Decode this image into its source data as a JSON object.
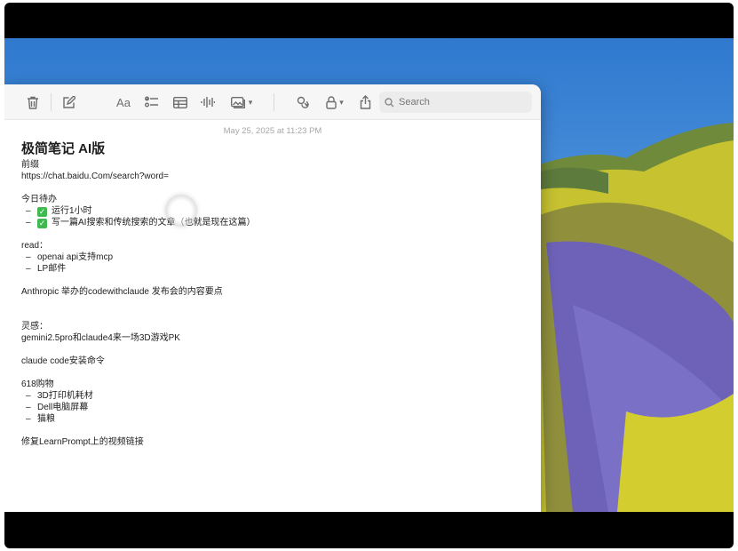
{
  "toolbar": {
    "buttons": [
      {
        "name": "delete-button",
        "icon": "trash-icon"
      },
      {
        "name": "new-note-button",
        "icon": "compose-icon"
      },
      {
        "name": "format-button",
        "icon": "text-format-icon",
        "label": "Aa"
      },
      {
        "name": "checklist-button",
        "icon": "checklist-icon"
      },
      {
        "name": "table-button",
        "icon": "table-icon"
      },
      {
        "name": "audio-button",
        "icon": "waveform-icon"
      },
      {
        "name": "media-button",
        "icon": "photo-icon"
      },
      {
        "name": "collaborate-button",
        "icon": "link-icon"
      },
      {
        "name": "lock-button",
        "icon": "lock-icon"
      },
      {
        "name": "share-button",
        "icon": "share-icon"
      }
    ],
    "search_placeholder": "Search"
  },
  "note": {
    "date": "May 25, 2025 at 11:23 PM",
    "title": "极简笔记 AI版",
    "lines": {
      "l1": "前缀",
      "l2": "https://chat.baidu.Com/search?word=",
      "l3": "今日待办",
      "todo1": "运行1小时",
      "todo2": "写一篇AI搜索和传统搜索的文章（也就是现在这篇）",
      "l4": "read：",
      "read1": "openai api支持mcp",
      "read2": "LP邮件",
      "l5": "Anthropic 举办的codewithclaude 发布会的内容要点",
      "l6": "灵感：",
      "l7": "gemini2.5pro和claude4来一场3D游戏PK",
      "l8": "claude code安装命令",
      "l9": "618购物",
      "shop1": "3D打印机耗材",
      "shop2": "Dell电脑屏幕",
      "shop3": "猫粮",
      "l10": "修复LearnPrompt上的视频链接"
    },
    "dash": "–",
    "check_glyph": "✓"
  }
}
